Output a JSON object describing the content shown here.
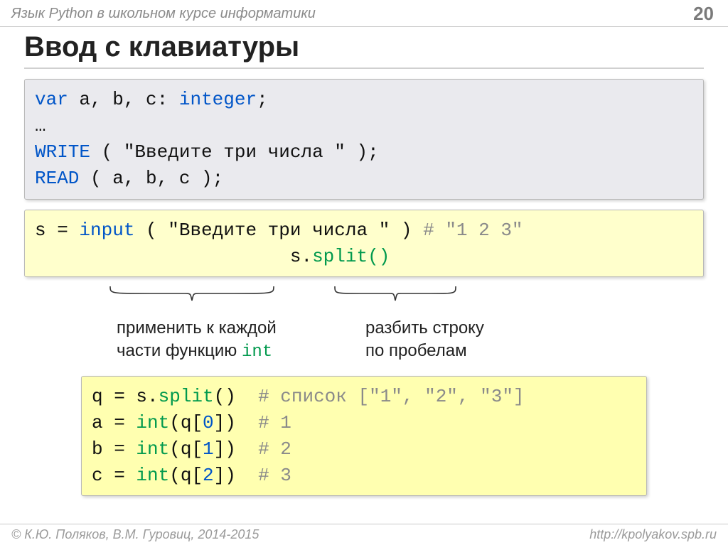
{
  "header": {
    "course": "Язык Python в школьном курсе информатики",
    "page": "20"
  },
  "title": "Ввод с клавиатуры",
  "pascal": {
    "l1a": "var ",
    "l1b": "a, b, c: ",
    "l1c": "integer",
    "l1d": ";",
    "l2": "…",
    "l3a": "WRITE ",
    "l3b": "( \"Введите три числа \" );",
    "l4a": "READ ",
    "l4b": "( a, b, c );"
  },
  "py1": {
    "l1a": "s = ",
    "l1b": "input",
    "l1c": " ( \"Введите три числа \" ) ",
    "l1d": "# \"1 2 3\"",
    "l2pad": "                       ",
    "l2a": "s.",
    "l2b": "split",
    "l2c": "()"
  },
  "ann": {
    "left1": "применить к каждой",
    "left2": "части функцию ",
    "left2b": "int",
    "right1": "разбить строку",
    "right2": "по пробелам"
  },
  "py2": {
    "l1a": "q = s.",
    "l1b": "split",
    "l1c": "()  ",
    "l1d": "# список [\"1\", \"2\", \"3\"]",
    "l2a": "a = ",
    "l2b": "int",
    "l2c": "(q[",
    "l2d": "0",
    "l2e": "])  ",
    "l2f": "# 1",
    "l3a": "b = ",
    "l3b": "int",
    "l3c": "(q[",
    "l3d": "1",
    "l3e": "])  ",
    "l3f": "# 2",
    "l4a": "c = ",
    "l4b": "int",
    "l4c": "(q[",
    "l4d": "2",
    "l4e": "])  ",
    "l4f": "# 3"
  },
  "footer": {
    "left": "© К.Ю. Поляков, В.М. Гуровиц, 2014-2015",
    "right": "http://kpolyakov.spb.ru"
  }
}
